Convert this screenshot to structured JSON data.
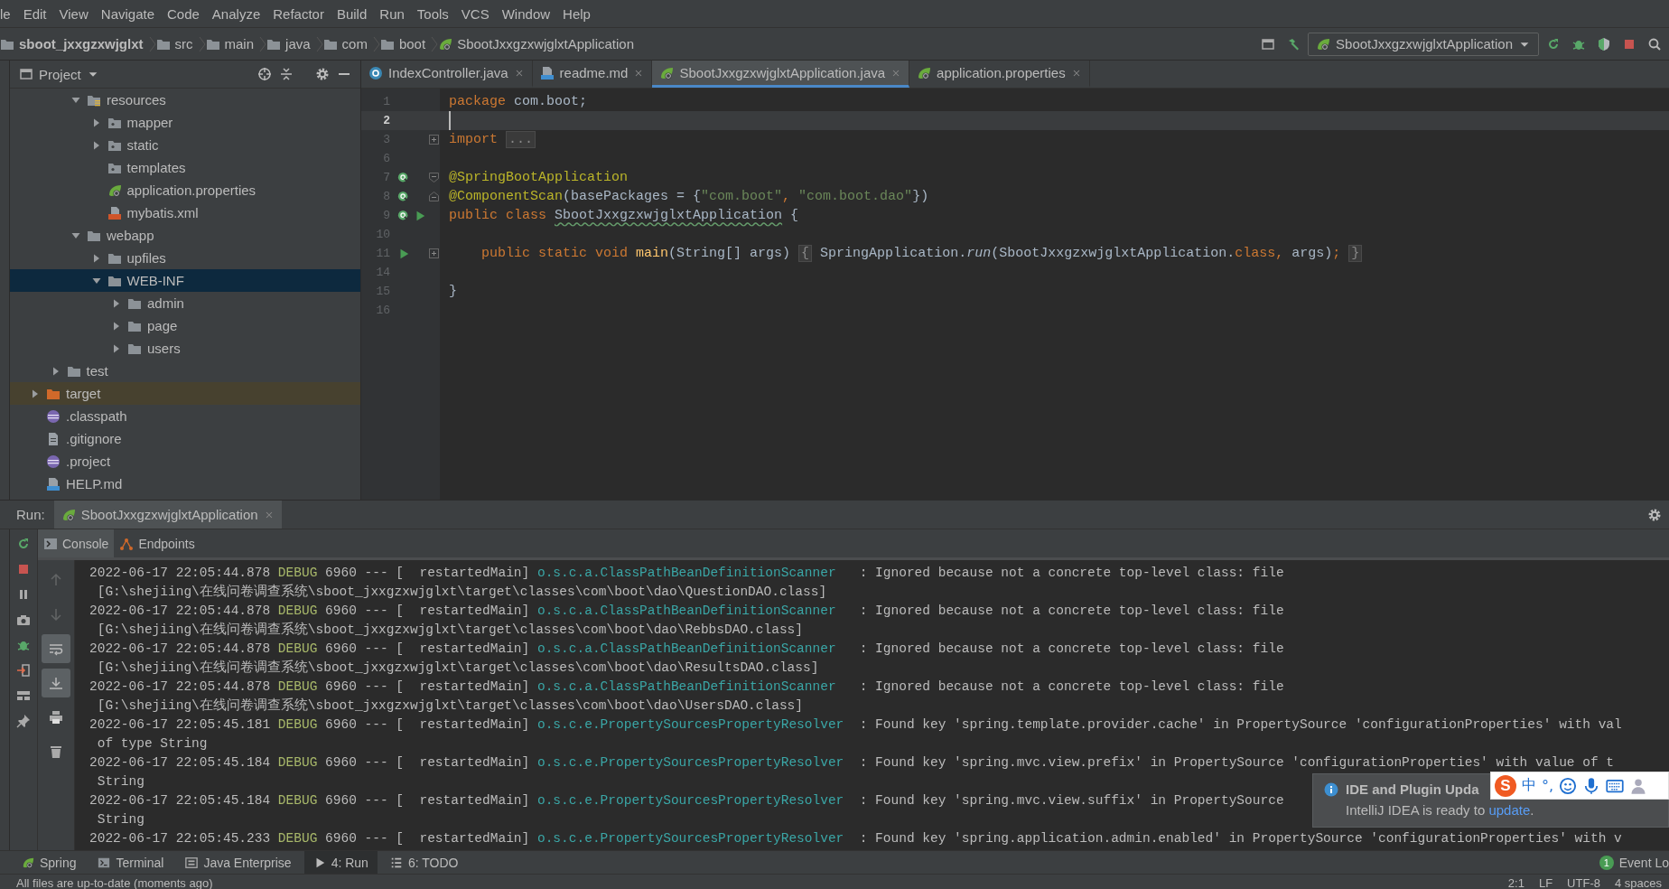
{
  "menu": [
    "le",
    "Edit",
    "View",
    "Navigate",
    "Code",
    "Analyze",
    "Refactor",
    "Build",
    "Run",
    "Tools",
    "VCS",
    "Window",
    "Help"
  ],
  "breadcrumbs": [
    {
      "label": "sboot_jxxgzxwjglxt",
      "kind": "project"
    },
    {
      "label": "src",
      "kind": "folder"
    },
    {
      "label": "main",
      "kind": "folder"
    },
    {
      "label": "java",
      "kind": "folder"
    },
    {
      "label": "com",
      "kind": "folder"
    },
    {
      "label": "boot",
      "kind": "folder"
    },
    {
      "label": "SbootJxxgzxwjglxtApplication",
      "kind": "spring"
    }
  ],
  "toolbar": {
    "icons_left": [
      {
        "kind": "window"
      },
      {
        "kind": "hammer"
      }
    ],
    "run_config": "SbootJxxgzxwjglxtApplication",
    "icons_right": [
      {
        "kind": "rerun"
      },
      {
        "kind": "debug"
      },
      {
        "kind": "coverage"
      },
      {
        "kind": "stop"
      },
      {
        "kind": "search"
      }
    ]
  },
  "project_panel": {
    "title": "Project",
    "tree": [
      {
        "children": [
          {
            "children": [
              {
                "label": "resources",
                "kind": "resources",
                "expanded": true,
                "selected": false,
                "ignored": false,
                "children": [
                  {
                    "label": "mapper",
                    "kind": "resfolder",
                    "expanded": false,
                    "selected": false,
                    "ignored": false
                  },
                  {
                    "label": "static",
                    "kind": "resfolder",
                    "expanded": false,
                    "selected": false,
                    "ignored": false
                  },
                  {
                    "label": "templates",
                    "kind": "resfolder",
                    "selected": false,
                    "ignored": false
                  },
                  {
                    "label": "application.properties",
                    "kind": "spring",
                    "selected": false,
                    "ignored": false
                  },
                  {
                    "label": "mybatis.xml",
                    "kind": "xml",
                    "selected": false,
                    "ignored": false
                  }
                ]
              },
              {
                "label": "webapp",
                "kind": "folder",
                "expanded": true,
                "selected": false,
                "ignored": false,
                "children": [
                  {
                    "label": "upfiles",
                    "kind": "folder",
                    "expanded": false,
                    "selected": false,
                    "ignored": false
                  },
                  {
                    "label": "WEB-INF",
                    "kind": "folder",
                    "expanded": true,
                    "selected": true,
                    "ignored": false,
                    "children": [
                      {
                        "label": "admin",
                        "kind": "folder",
                        "expanded": false,
                        "selected": false,
                        "ignored": false
                      },
                      {
                        "label": "page",
                        "kind": "folder",
                        "expanded": false,
                        "selected": false,
                        "ignored": false
                      },
                      {
                        "label": "users",
                        "kind": "folder",
                        "expanded": false,
                        "selected": false,
                        "ignored": false
                      }
                    ]
                  }
                ]
              }
            ]
          },
          {
            "label": "test",
            "kind": "folder",
            "expanded": false,
            "selected": false,
            "ignored": false
          }
        ]
      },
      {
        "label": "target",
        "kind": "excluded",
        "expanded": false,
        "selected": false,
        "ignored": true
      },
      {
        "label": ".classpath",
        "kind": "eclipse",
        "selected": false,
        "ignored": false
      },
      {
        "label": ".gitignore",
        "kind": "text",
        "selected": false,
        "ignored": false
      },
      {
        "label": ".project",
        "kind": "eclipse",
        "selected": false,
        "ignored": false
      },
      {
        "label": "HELP.md",
        "kind": "md",
        "selected": false,
        "ignored": false
      }
    ]
  },
  "editor": {
    "tabs": [
      {
        "label": "IndexController.java",
        "kind": "class",
        "selected": false
      },
      {
        "label": "readme.md",
        "kind": "md",
        "selected": false
      },
      {
        "label": "SbootJxxgzxwjglxtApplication.java",
        "kind": "spring",
        "selected": true
      },
      {
        "label": "application.properties",
        "kind": "spring",
        "selected": false
      }
    ],
    "lines": [
      {
        "number": "1",
        "current": false,
        "tokens": [
          {
            "kind": "kw",
            "text": "package"
          },
          {
            "kind": "plain",
            "text": " com.boot;"
          }
        ]
      },
      {
        "number": "2",
        "current": true
      },
      {
        "number": "3",
        "current": false,
        "fold": {
          "kind": "collapsed"
        },
        "tokens": [
          {
            "kind": "kw",
            "text": "import "
          },
          {
            "kind": "folded",
            "text": "..."
          }
        ]
      },
      {
        "number": "6",
        "current": false
      },
      {
        "number": "7",
        "current": false,
        "fold": {
          "kind": "start"
        },
        "markers": [
          {
            "kind": "bean"
          }
        ],
        "tokens": [
          {
            "kind": "annotation",
            "text": "@SpringBootApplication"
          }
        ]
      },
      {
        "number": "8",
        "current": false,
        "fold": {
          "kind": "end"
        },
        "markers": [
          {
            "kind": "bean"
          }
        ],
        "tokens": [
          {
            "kind": "annotation",
            "text": "@ComponentScan"
          },
          {
            "kind": "plain",
            "text": "(basePackages = {"
          },
          {
            "kind": "string",
            "text": "\"com.boot\""
          },
          {
            "kind": "kw",
            "text": ", "
          },
          {
            "kind": "string",
            "text": "\"com.boot.dao\""
          },
          {
            "kind": "plain",
            "text": "})"
          }
        ]
      },
      {
        "number": "9",
        "current": false,
        "markers": [
          {
            "kind": "bean"
          },
          {
            "kind": "run"
          }
        ],
        "tokens": [
          {
            "kind": "kw",
            "text": "public class "
          },
          {
            "kind": "typo",
            "text": "SbootJxxgzxwjglxtApplication"
          },
          {
            "kind": "plain",
            "text": " {"
          }
        ]
      },
      {
        "number": "10",
        "current": false
      },
      {
        "number": "11",
        "current": false,
        "fold": {
          "kind": "collapsed"
        },
        "markers": [
          {
            "kind": "run"
          }
        ],
        "tokens": [
          {
            "kind": "kw",
            "text": "    public static void "
          },
          {
            "kind": "method",
            "text": "main"
          },
          {
            "kind": "plain",
            "text": "(String[] args) "
          },
          {
            "kind": "folded",
            "text": "{"
          },
          {
            "kind": "plain",
            "text": " SpringApplication."
          },
          {
            "kind": "italic",
            "text": "run"
          },
          {
            "kind": "plain",
            "text": "(SbootJxxgzxwjglxtApplication."
          },
          {
            "kind": "kw",
            "text": "class, "
          },
          {
            "kind": "plain",
            "text": "args)"
          },
          {
            "kind": "kw",
            "text": "; "
          },
          {
            "kind": "folded",
            "text": "}"
          }
        ]
      },
      {
        "number": "14",
        "current": false
      },
      {
        "number": "15",
        "current": false,
        "tokens": [
          {
            "kind": "plain",
            "text": "}"
          }
        ]
      },
      {
        "number": "16",
        "current": false
      }
    ]
  },
  "run_panel": {
    "label": "Run:",
    "tab": "SbootJxxgzxwjglxtApplication",
    "run_tools": [
      {
        "kind": "rerun"
      },
      {
        "kind": "stop"
      },
      {
        "kind": "pause"
      },
      {
        "kind": "camera"
      },
      {
        "kind": "debug"
      },
      {
        "kind": "exit"
      },
      {
        "kind": "layout"
      },
      {
        "kind": "pin"
      }
    ],
    "console_tabs": [
      {
        "label": "Console",
        "kind": "console",
        "selected": true
      },
      {
        "label": "Endpoints",
        "kind": "endpoints",
        "selected": false
      }
    ],
    "console_tools": [
      {
        "kind": "up",
        "on": false,
        "disabled": true
      },
      {
        "kind": "down",
        "on": false,
        "disabled": true
      },
      {
        "kind": "wrap",
        "on": true,
        "disabled": false
      },
      {
        "kind": "scroll-end",
        "on": true,
        "disabled": false
      },
      {
        "kind": "print",
        "on": false,
        "disabled": false
      },
      {
        "kind": "trash",
        "on": false,
        "disabled": false
      }
    ],
    "log": [
      {
        "time": "2022-06-17 22:05:44.878",
        "level": "DEBUG",
        "pid": "6960 ---",
        "thread": "[  restartedMain]",
        "logger": "o.s.c.a.ClassPathBeanDefinitionScanner",
        "message": ": Ignored because not a concrete top-level class: file",
        "continuation": "[G:\\shejiing\\在线问卷调查系统\\sboot_jxxgzxwjglxt\\target\\classes\\com\\boot\\dao\\QuestionDAO.class]"
      },
      {
        "time": "2022-06-17 22:05:44.878",
        "level": "DEBUG",
        "pid": "6960 ---",
        "thread": "[  restartedMain]",
        "logger": "o.s.c.a.ClassPathBeanDefinitionScanner",
        "message": ": Ignored because not a concrete top-level class: file",
        "continuation": "[G:\\shejiing\\在线问卷调查系统\\sboot_jxxgzxwjglxt\\target\\classes\\com\\boot\\dao\\RebbsDAO.class]"
      },
      {
        "time": "2022-06-17 22:05:44.878",
        "level": "DEBUG",
        "pid": "6960 ---",
        "thread": "[  restartedMain]",
        "logger": "o.s.c.a.ClassPathBeanDefinitionScanner",
        "message": ": Ignored because not a concrete top-level class: file",
        "continuation": "[G:\\shejiing\\在线问卷调查系统\\sboot_jxxgzxwjglxt\\target\\classes\\com\\boot\\dao\\ResultsDAO.class]"
      },
      {
        "time": "2022-06-17 22:05:44.878",
        "level": "DEBUG",
        "pid": "6960 ---",
        "thread": "[  restartedMain]",
        "logger": "o.s.c.a.ClassPathBeanDefinitionScanner",
        "message": ": Ignored because not a concrete top-level class: file",
        "continuation": "[G:\\shejiing\\在线问卷调查系统\\sboot_jxxgzxwjglxt\\target\\classes\\com\\boot\\dao\\UsersDAO.class]"
      },
      {
        "time": "2022-06-17 22:05:45.181",
        "level": "DEBUG",
        "pid": "6960 ---",
        "thread": "[  restartedMain]",
        "logger": "o.s.c.e.PropertySourcesPropertyResolver",
        "message": ": Found key 'spring.template.provider.cache' in PropertySource 'configurationProperties' with val",
        "continuation": "of type String"
      },
      {
        "time": "2022-06-17 22:05:45.184",
        "level": "DEBUG",
        "pid": "6960 ---",
        "thread": "[  restartedMain]",
        "logger": "o.s.c.e.PropertySourcesPropertyResolver",
        "message": ": Found key 'spring.mvc.view.prefix' in PropertySource 'configurationProperties' with value of t",
        "continuation": "String"
      },
      {
        "time": "2022-06-17 22:05:45.184",
        "level": "DEBUG",
        "pid": "6960 ---",
        "thread": "[  restartedMain]",
        "logger": "o.s.c.e.PropertySourcesPropertyResolver",
        "message": ": Found key 'spring.mvc.view.suffix' in PropertySource",
        "continuation": "String"
      },
      {
        "time": "2022-06-17 22:05:45.233",
        "level": "DEBUG",
        "pid": "6960 ---",
        "thread": "[  restartedMain]",
        "logger": "o.s.c.e.PropertySourcesPropertyResolver",
        "message": ": Found key 'spring.application.admin.enabled' in PropertySource 'configurationProperties' with v"
      }
    ]
  },
  "tool_buttons": [
    {
      "label": "Spring",
      "kind": "spring",
      "selected": false
    },
    {
      "label": "Terminal",
      "kind": "terminal",
      "selected": false
    },
    {
      "label": "Java Enterprise",
      "kind": "javaee",
      "selected": false
    },
    {
      "label": "4: Run",
      "kind": "run",
      "selected": true
    },
    {
      "label": "6: TODO",
      "kind": "todo",
      "selected": false
    }
  ],
  "event_log": {
    "badge": "1",
    "label": "Event Lo"
  },
  "status_bar": {
    "message": "All files are up-to-date (moments ago)",
    "items": [
      "2:1",
      "LF",
      "UTF-8",
      "4 spaces"
    ]
  },
  "notification": {
    "title": "IDE and Plugin Upda",
    "text": "IntelliJ IDEA is ready to ",
    "link": "update",
    "after": "."
  },
  "ime_toolbar": {
    "logo": "S",
    "items": [
      "中",
      "°,"
    ]
  }
}
